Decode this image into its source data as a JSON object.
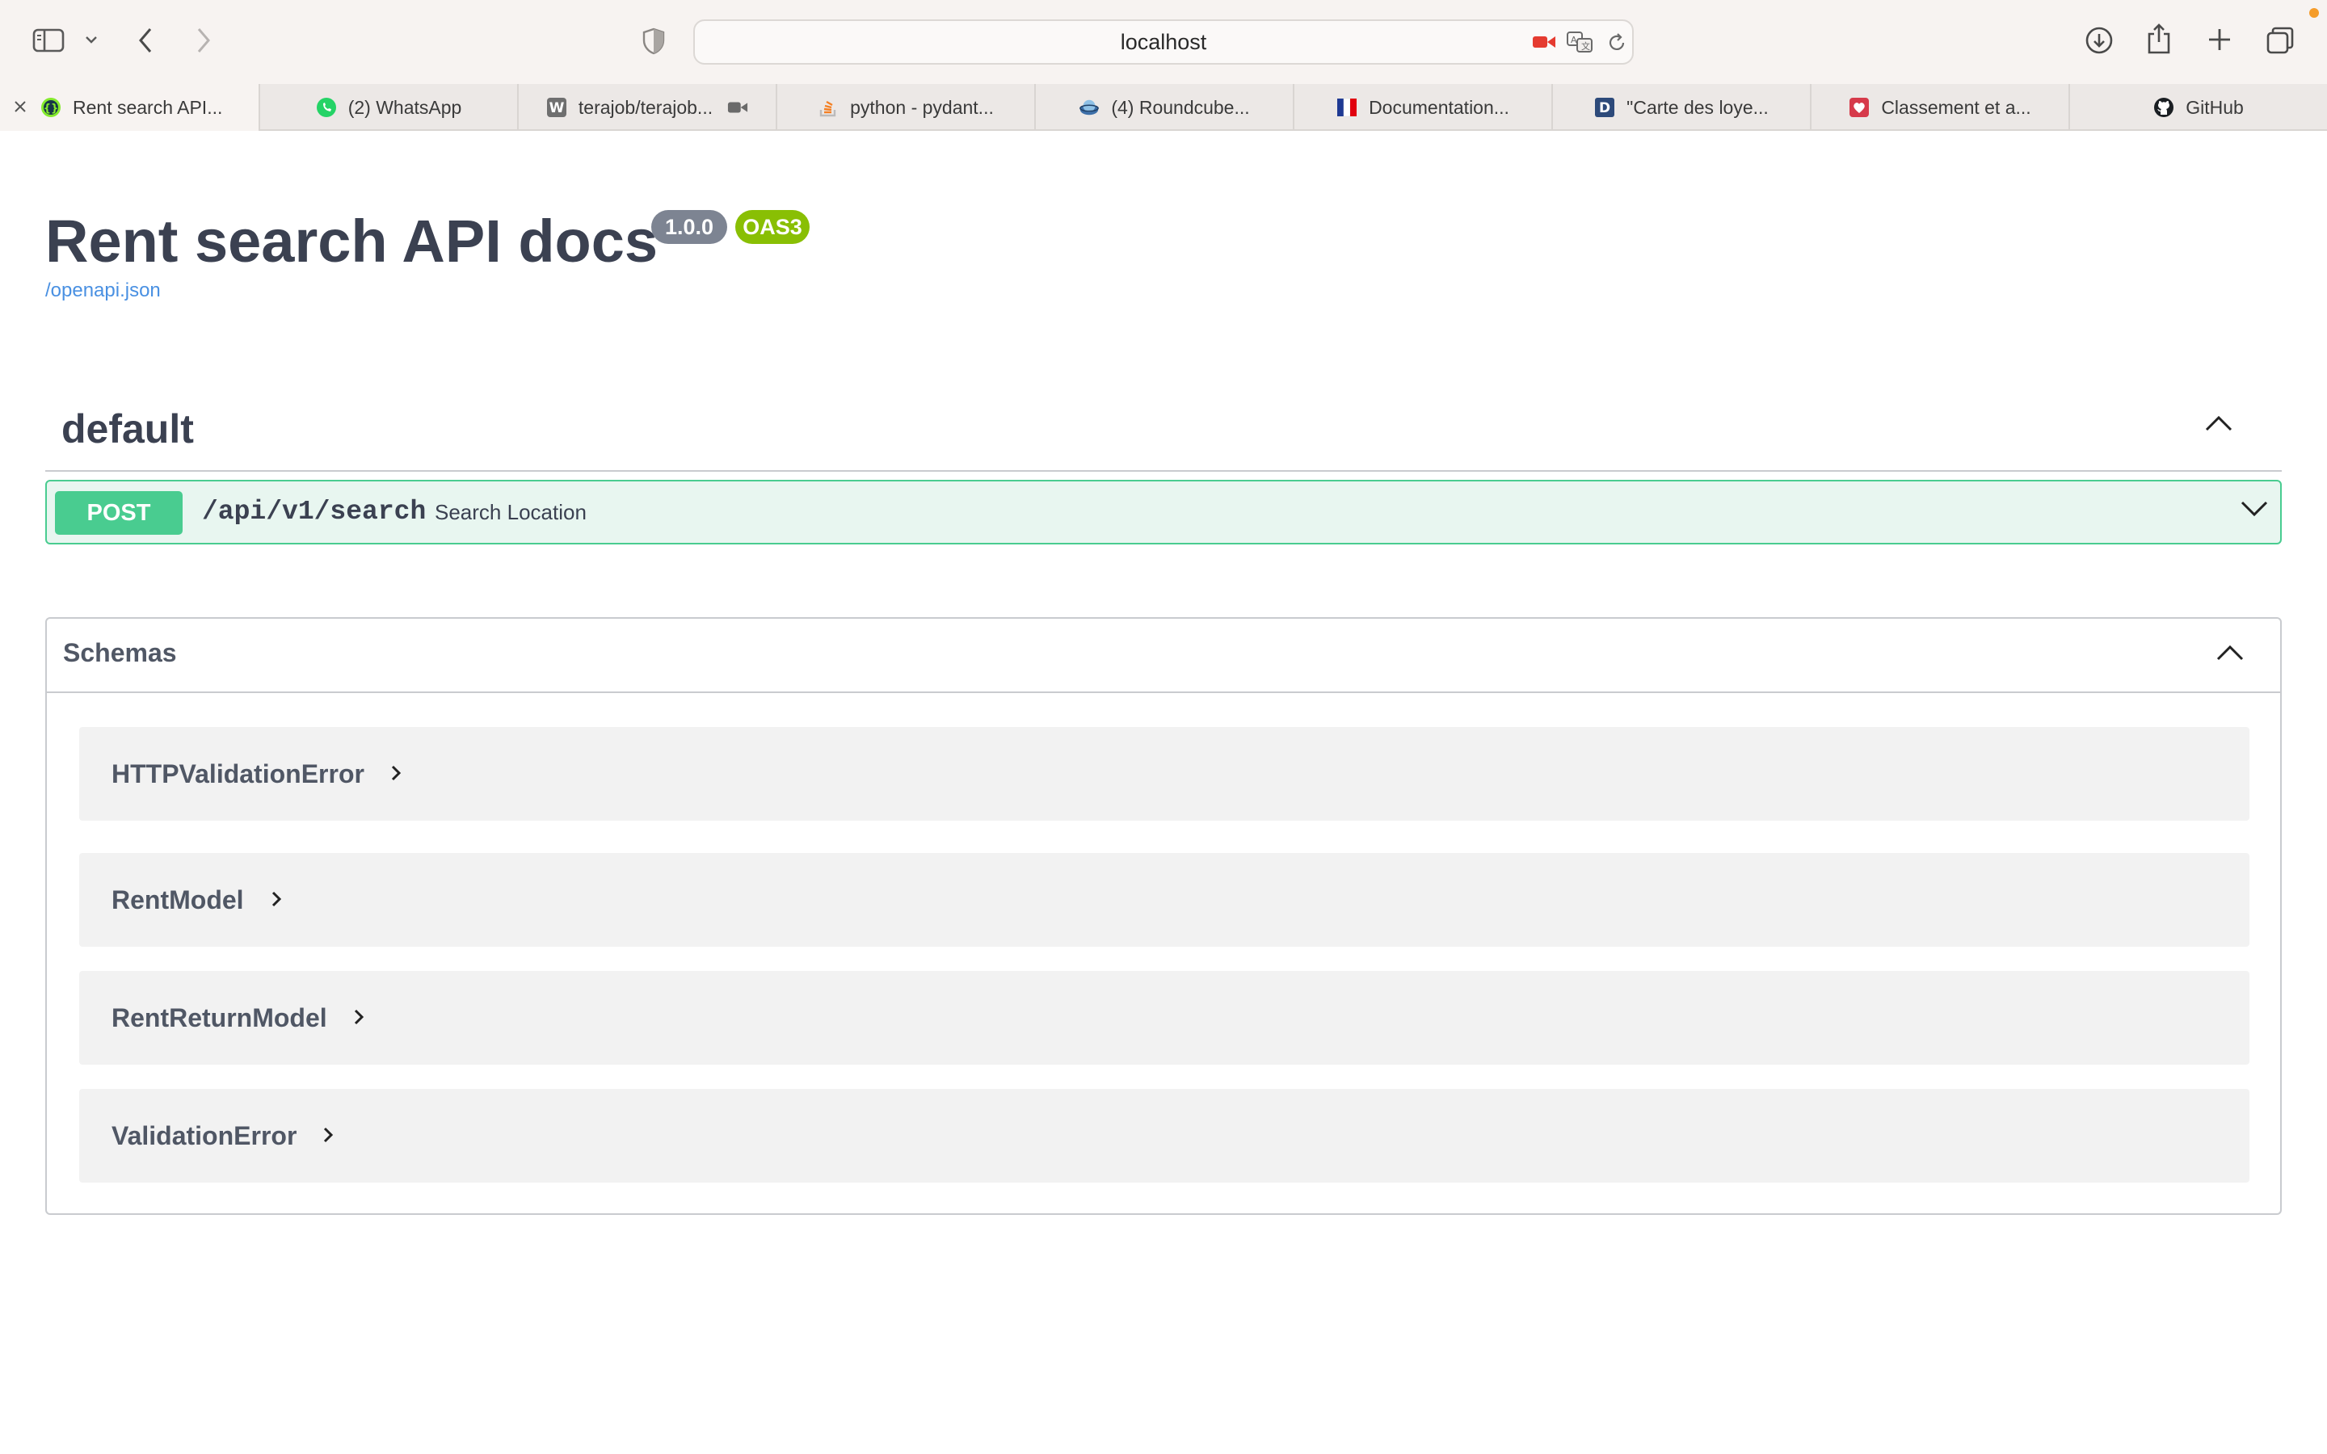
{
  "browser": {
    "url": "localhost",
    "tabs": [
      {
        "title": "Rent search API...",
        "favicon": "swagger-icon",
        "active": true
      },
      {
        "title": "(2) WhatsApp",
        "favicon": "whatsapp-icon"
      },
      {
        "title": "terajob/terajob...",
        "favicon": "w-letter-icon"
      },
      {
        "title": "python - pydant...",
        "favicon": "stackoverflow-icon"
      },
      {
        "title": "(4) Roundcube...",
        "favicon": "roundcube-icon"
      },
      {
        "title": "Documentation...",
        "favicon": "french-gov-icon"
      },
      {
        "title": "\"Carte des loye...",
        "favicon": "d-letter-icon"
      },
      {
        "title": "Classement et a...",
        "favicon": "heart-icon"
      },
      {
        "title": "GitHub",
        "favicon": "github-icon"
      }
    ]
  },
  "info": {
    "title": "Rent search API docs",
    "version": "1.0.0",
    "oas": "OAS3",
    "spec_link": "/openapi.json"
  },
  "tag": {
    "name": "default"
  },
  "operation": {
    "method": "POST",
    "path": "/api/v1/search",
    "summary": "Search Location"
  },
  "models": {
    "title": "Schemas",
    "items": [
      {
        "name": "HTTPValidationError"
      },
      {
        "name": "RentModel"
      },
      {
        "name": "RentReturnModel"
      },
      {
        "name": "ValidationError"
      }
    ]
  },
  "colors": {
    "post": "#49cc90",
    "post_bg": "#e8f6f0",
    "version_badge": "#7d8492",
    "oas_badge": "#89bf04",
    "link": "#4990e2"
  }
}
